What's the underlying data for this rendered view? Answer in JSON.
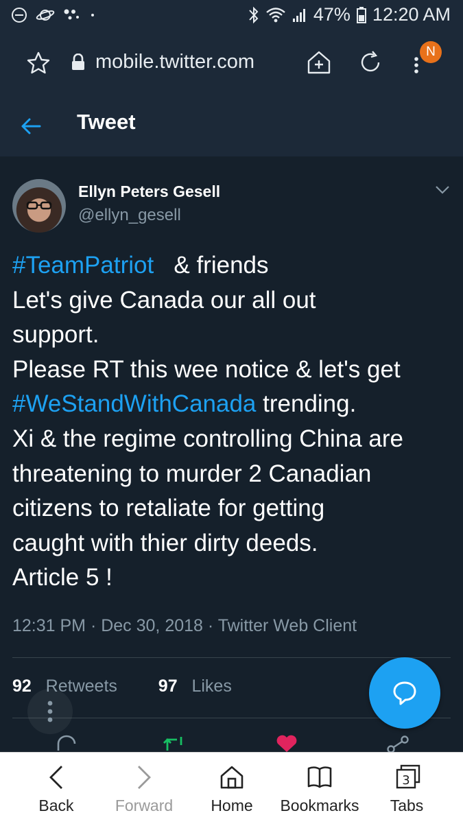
{
  "status_bar": {
    "battery": "47%",
    "time": "12:20 AM"
  },
  "browser": {
    "url": "mobile.twitter.com",
    "notification_badge": "N"
  },
  "header": {
    "title": "Tweet"
  },
  "tweet": {
    "author_name": "Ellyn Peters Gesell",
    "author_handle": "@ellyn_gesell",
    "body_lines": [
      {
        "hashtag": "#TeamPatriot",
        "text": "   & friends"
      },
      {
        "text": "Let's give Canada our all out"
      },
      {
        "text": "support."
      },
      {
        "text": "Please RT this wee notice & let's get"
      },
      {
        "hashtag": "#WeStandWithCanada",
        "text": " trending."
      },
      {
        "text": "Xi & the regime controlling China are"
      },
      {
        "text": "threatening to murder 2 Canadian"
      },
      {
        "text": "citizens to retaliate for getting"
      },
      {
        "text": "caught with thier dirty deeds."
      },
      {
        "text": "Article 5 !"
      }
    ],
    "meta": "12:31 PM · Dec 30, 2018 · Twitter Web Client",
    "retweets_count": "92",
    "retweets_label": "Retweets",
    "likes_count": "97",
    "likes_label": "Likes"
  },
  "bottom_nav": {
    "back": "Back",
    "forward": "Forward",
    "home": "Home",
    "bookmarks": "Bookmarks",
    "tabs": "Tabs",
    "tab_count": "3"
  },
  "colors": {
    "background": "#15202b",
    "bar": "#1c2938",
    "accent": "#1da1f2",
    "muted": "#8899a6",
    "like": "#e0245e",
    "retweet": "#17bf63"
  }
}
